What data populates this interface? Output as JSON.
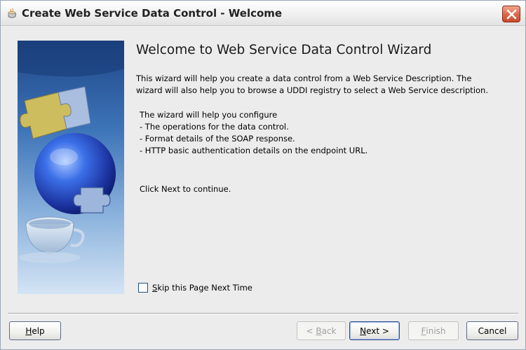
{
  "window": {
    "title": "Create Web Service Data Control - Welcome"
  },
  "content": {
    "heading": "Welcome to Web Service Data Control Wizard",
    "intro_line1": "This wizard will help you create a data control from a Web Service Description. The",
    "intro_line2": "wizard will also help you to browse a UDDI registry to select a Web Service description.",
    "configure_header": "The wizard will help you configure",
    "configure_items": [
      " - The operations for the data control.",
      " - Format details of the SOAP response.",
      " - HTTP basic authentication details on the endpoint URL."
    ],
    "continue_text": "Click Next to continue.",
    "skip_label_mnemonic": "S",
    "skip_label_rest": "kip this Page Next Time",
    "skip_checked": false
  },
  "buttons": {
    "help_mnemonic": "H",
    "help_rest": "elp",
    "back_prefix": "< ",
    "back_mnemonic": "B",
    "back_rest": "ack",
    "next_mnemonic": "N",
    "next_rest": "ext >",
    "finish_mnemonic": "F",
    "finish_rest": "inish",
    "cancel": "Cancel"
  },
  "colors": {
    "banner_top": "#1f4a8e",
    "banner_bottom": "#cfe0f2",
    "globe": "#2a5ad8",
    "puzzle": "#d8c25a"
  }
}
